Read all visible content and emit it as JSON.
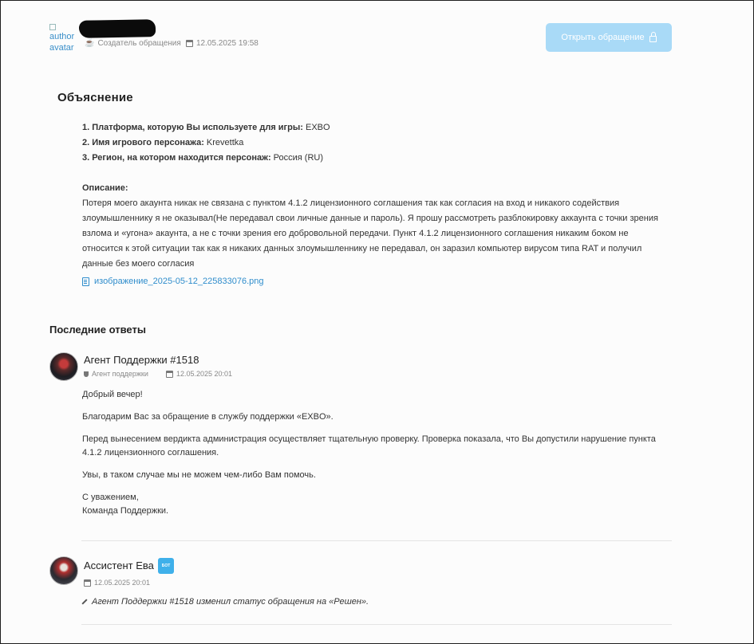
{
  "header": {
    "avatar_alt": "author avatar",
    "author_role": "Создатель обращения",
    "created_at": "12.05.2025 19:58",
    "open_button_label": "Открыть обращение"
  },
  "explanation": {
    "title": "Объяснение",
    "fields": [
      {
        "label": "1. Платформа, которую Вы используете для игры:",
        "value": " EXBO"
      },
      {
        "label": "2. Имя игрового персонажа:",
        "value": " Krevettka"
      },
      {
        "label": "3. Регион, на котором находится персонаж:",
        "value": " Россия (RU)"
      }
    ],
    "description_label": "Описание:",
    "description_lines": [
      "Потеря моего акаунта никак не связана с пунктом 4.1.2 лицензионного соглашения так как согласия на вход и никакого содействия",
      "злоумышленнику я не оказывал(Не передавал свои личные данные и пароль). Я прошу рассмотреть разблокировку аккаунта с точки зрения",
      "взлома и «угона» акаунта, а не с точки зрения его добровольной передачи. Пункт 4.1.2 лицензионного соглашения никаким боком не",
      "относится к этой ситуации так как я никаких данных злоумышленнику не передавал, он заразил компьютер вирусом типа RAT и получил",
      "данные без моего согласия"
    ],
    "attachment": "изображение_2025-05-12_225833076.png"
  },
  "replies": {
    "title": "Последние ответы",
    "items": [
      {
        "name": "Агент Поддержки #1518",
        "role": "Агент поддержки",
        "date": "12.05.2025 20:01",
        "paragraphs": [
          "Добрый вечер!",
          "Благодарим Вас за обращение в службу поддержки «EXBO».",
          "Перед вынесением вердикта администрация осуществляет тщательную проверку. Проверка показала, что Вы допустили нарушение пункта",
          "4.1.2 лицензионного соглашения.",
          "Увы, в таком случае мы не можем чем-либо Вам помочь.",
          "С уважением,",
          "Команда Поддержки."
        ]
      },
      {
        "name": "Ассистент Ева",
        "badge": "БОТ",
        "date": "12.05.2025 20:01",
        "status_text": "Агент Поддержки #1518 изменил статус обращения на «Решен»."
      }
    ]
  }
}
